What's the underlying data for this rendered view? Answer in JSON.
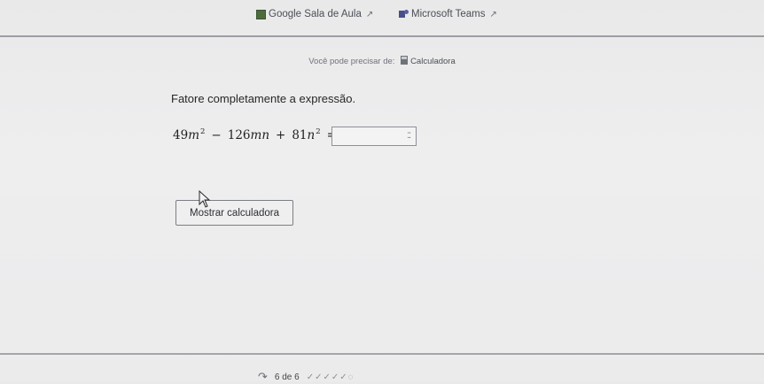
{
  "header": {
    "links": [
      {
        "label": "Google Sala de Aula",
        "icon": "google-classroom-icon"
      },
      {
        "label": "Microsoft Teams",
        "icon": "microsoft-teams-icon"
      }
    ],
    "external_icon": "external-link-icon"
  },
  "hint": {
    "text": "Você pode precisar de:",
    "link_label": "Calculadora",
    "icon": "calculator-icon"
  },
  "question": {
    "prompt": "Fatore completamente a expressão.",
    "expression": {
      "t1_coef": "49",
      "t1_var": "m",
      "t1_exp": "2",
      "op1": "−",
      "t2_coef": "126",
      "t2_var": "mn",
      "op2": "+",
      "t3_coef": "81",
      "t3_var": "n",
      "t3_exp": "2",
      "eq": "="
    },
    "answer_value": "",
    "answer_icon": "math-keypad-icon"
  },
  "actions": {
    "calculator_button": "Mostrar calculadora"
  },
  "footer": {
    "progress": "6 de 6"
  },
  "colors": {
    "background": "#ececed",
    "divider": "#9c9ea3",
    "text": "#262626"
  }
}
